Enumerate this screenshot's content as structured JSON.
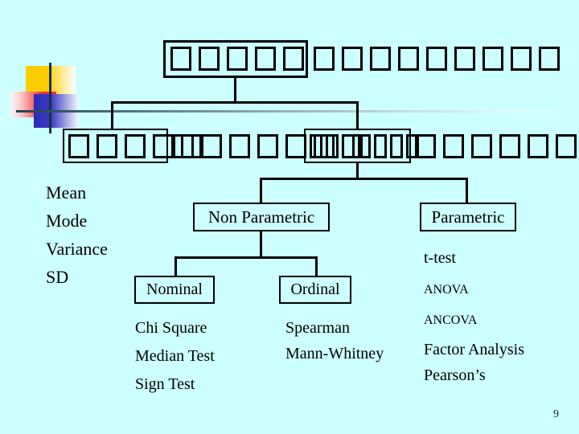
{
  "slide": {
    "background_color": "#CCFFFF",
    "page_number": "9"
  },
  "decoration": {
    "yellow_block": "yellow-gradient-block",
    "red_block": "red-gradient-block",
    "blue_block": "blue-gradient-block",
    "vertical_rule": "vertical-accent-rule",
    "horizontal_rule": "horizontal-fading-rule"
  },
  "diagram": {
    "title_box": {
      "glyph": "□",
      "inside_count": 5,
      "trailing_count": 9,
      "trailing_glyph": "□"
    },
    "level2": {
      "left_box": {
        "glyph": "□",
        "inside_count": 5,
        "trailing_count": 7,
        "trailing_glyph": "□"
      },
      "right_box": {
        "glyph": "□",
        "inside_count": 7,
        "trailing_count": 8,
        "trailing_glyph": "□"
      }
    },
    "descriptive_stats": {
      "items": [
        "Mean",
        "Mode",
        "Variance",
        "SD"
      ]
    },
    "non_parametric": {
      "label": "Non Parametric",
      "branches": [
        {
          "label": "Nominal",
          "tests": [
            "Chi Square",
            "Median Test",
            "Sign Test"
          ]
        },
        {
          "label": "Ordinal",
          "tests": [
            "Spearman",
            "Mann-Whitney"
          ]
        }
      ]
    },
    "parametric": {
      "label": "Parametric",
      "tests_large": [
        "t-test"
      ],
      "tests_small": [
        "ANOVA",
        "ANCOVA"
      ],
      "tests_large_2": [
        "Factor Analysis",
        "Pearson’s"
      ]
    }
  }
}
